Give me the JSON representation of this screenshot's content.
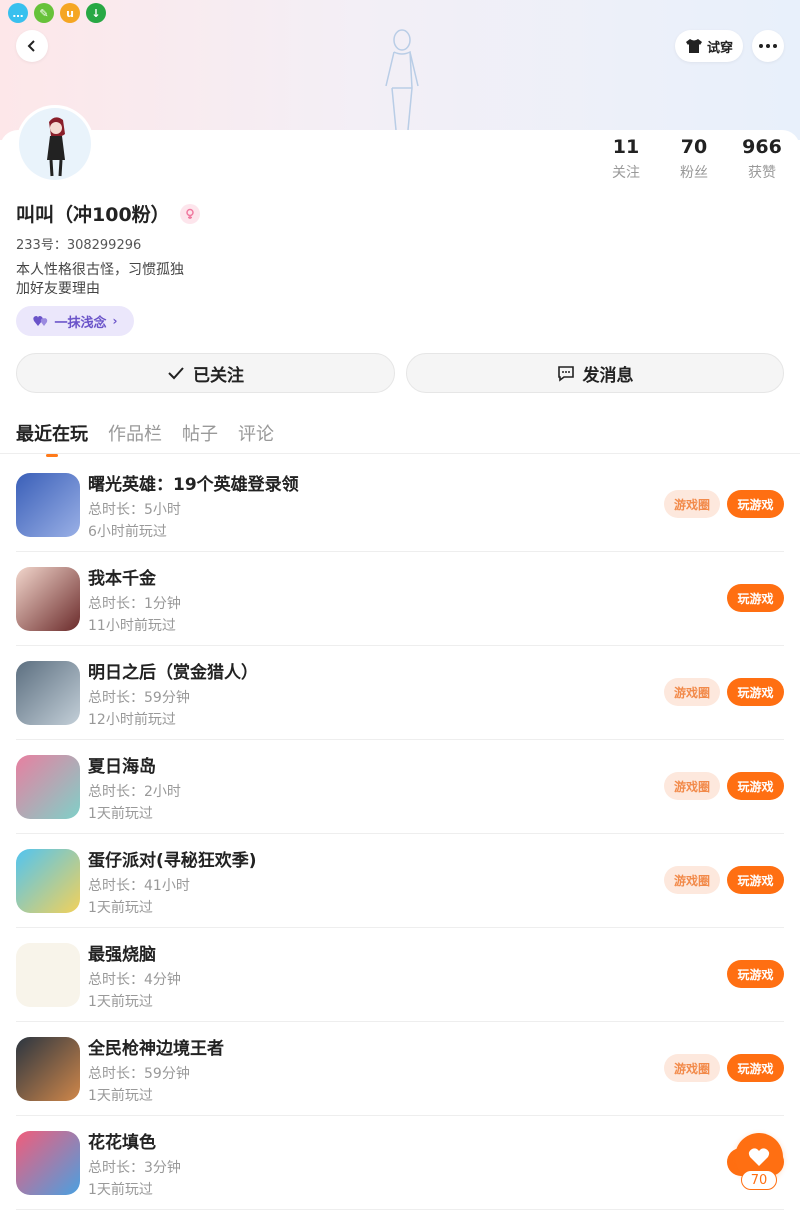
{
  "header": {
    "try_on_label": "试穿"
  },
  "stats": [
    {
      "value": "11",
      "label": "关注"
    },
    {
      "value": "70",
      "label": "粉丝"
    },
    {
      "value": "966",
      "label": "获赞"
    }
  ],
  "profile": {
    "name": "叫叫（冲100粉）",
    "uid": "233号：308299296",
    "bio_line1": "本人性格很古怪，习惯孤独",
    "bio_line2": "加好友要理由",
    "tag_label": "一抹浅念"
  },
  "actions": {
    "follow_label": "已关注",
    "message_label": "发消息"
  },
  "tabs": [
    "最近在玩",
    "作品栏",
    "帖子",
    "评论"
  ],
  "buttons": {
    "circle": "游戏圈",
    "play": "玩游戏"
  },
  "games": [
    {
      "title": "曙光英雄：19个英雄登录领",
      "duration": "总时长：5小时",
      "ago": "6小时前玩过",
      "has_circle": true
    },
    {
      "title": "我本千金",
      "duration": "总时长：1分钟",
      "ago": "11小时前玩过",
      "has_circle": false
    },
    {
      "title": "明日之后（赏金猎人）",
      "duration": "总时长：59分钟",
      "ago": "12小时前玩过",
      "has_circle": true
    },
    {
      "title": "夏日海岛",
      "duration": "总时长：2小时",
      "ago": "1天前玩过",
      "has_circle": true
    },
    {
      "title": "蛋仔派对(寻秘狂欢季)",
      "duration": "总时长：41小时",
      "ago": "1天前玩过",
      "has_circle": true
    },
    {
      "title": "最强烧脑",
      "duration": "总时长：4分钟",
      "ago": "1天前玩过",
      "has_circle": false
    },
    {
      "title": "全民枪神边境王者",
      "duration": "总时长：59分钟",
      "ago": "1天前玩过",
      "has_circle": true
    },
    {
      "title": "花花填色",
      "duration": "总时长：3分钟",
      "ago": "1天前玩过",
      "has_circle": false
    }
  ],
  "fab": {
    "count": "70"
  },
  "colors": {
    "accent": "#ff6f12",
    "tag_bg": "#ebe7fb",
    "tag_text": "#6a53c9"
  }
}
